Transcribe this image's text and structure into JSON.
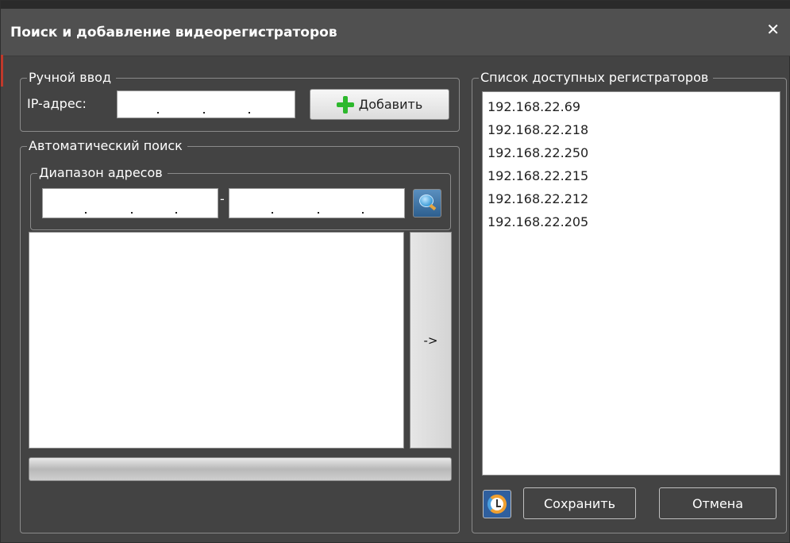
{
  "window": {
    "title": "Поиск и добавление видеорегистраторов",
    "close_glyph": "✕"
  },
  "manual": {
    "legend": "Ручной ввод",
    "ip_label": "IP-адрес:",
    "ip_value": "",
    "add_label": "Добавить",
    "add_icon": "plus-icon"
  },
  "auto": {
    "legend": "Автоматический поиск",
    "range_legend": "Диапазон адресов",
    "range_sep": "-",
    "range_from": "",
    "range_to": "",
    "search_icon": "search-icon",
    "move_label": "->",
    "progress": 0
  },
  "available": {
    "legend": "Список доступных регистраторов",
    "items": [
      "192.168.22.69",
      "192.168.22.218",
      "192.168.22.250",
      "192.168.22.215",
      "192.168.22.212",
      "192.168.22.205"
    ],
    "refresh_icon": "refresh-icon",
    "save_label": "Сохранить",
    "cancel_label": "Отмена"
  },
  "colors": {
    "background": "#434343",
    "titlebar": "#505050",
    "accent_green": "#2db82d"
  }
}
